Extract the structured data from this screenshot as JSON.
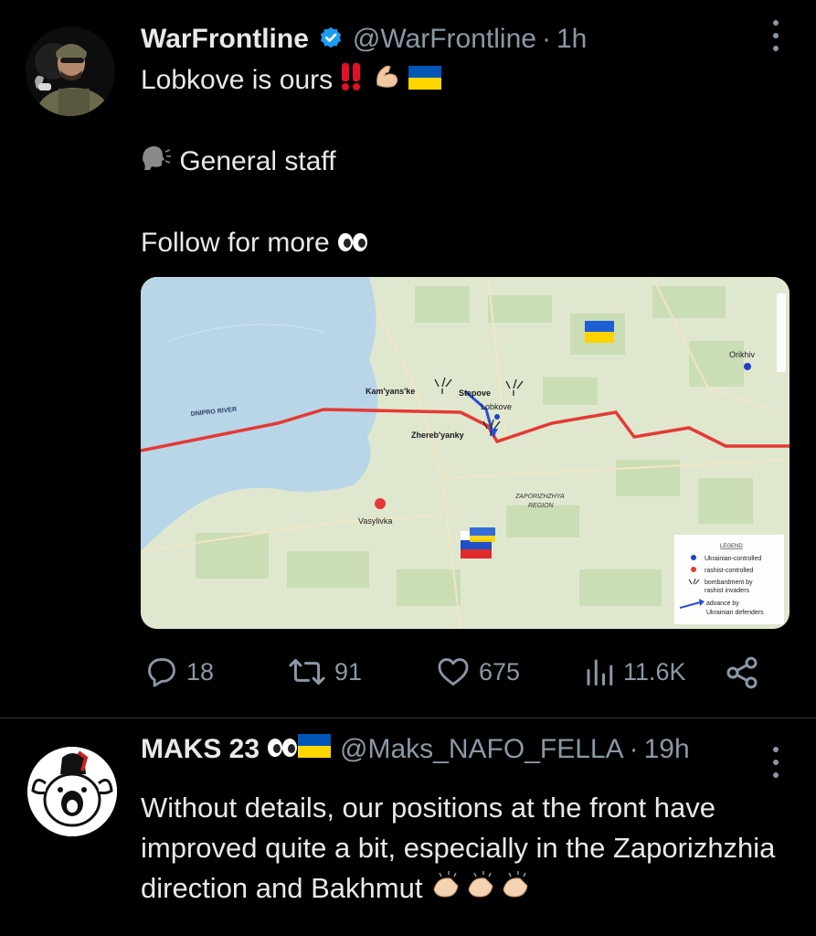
{
  "tweet1": {
    "author_name": "WarFrontline",
    "handle": "@WarFrontline",
    "separator": "·",
    "time": "1h",
    "line1": "Lobkove is ours",
    "line2": "General staff",
    "line3": "Follow for more",
    "stats": {
      "replies": "18",
      "retweets": "91",
      "likes": "675",
      "views": "11.6K"
    },
    "map": {
      "labels": {
        "river": "DNIPRO RIVER",
        "kamyanske": "Kam'yans'ke",
        "stepove": "Stepove",
        "lobkove": "Lobkove",
        "zherebyanky": "Zhereb'yanky",
        "orikhiv": "Orikhiv",
        "vasylivka": "Vasylivka",
        "region_1": "ZAPORIZHZHYA",
        "region_2": "REGION"
      },
      "legend": {
        "title": "LEGEND",
        "ukrainian": "Ukrainian-controlled",
        "rashist": "rashist-controlled",
        "bombardment_1": "bombardment by",
        "bombardment_2": "rashist invaders",
        "advance_1": "advance by",
        "advance_2": "Ukrainian defenders"
      },
      "colors": {
        "water": "#b9d6e8",
        "land": "#dfe8cf",
        "frontline": "#e53935",
        "ukraine_dot": "#1e40c8",
        "russia_dot": "#e53935"
      }
    }
  },
  "tweet2": {
    "author_name": "MAKS 23",
    "handle": "@Maks_NAFO_FELLA",
    "separator": "·",
    "time": "19h",
    "body": "Without details, our positions at the front have improved quite a bit, especially in the Zaporizhzhia direction and Bakhmut"
  },
  "icons": [
    "verified-badge-icon",
    "more-options-icon",
    "reply-icon",
    "retweet-icon",
    "like-icon",
    "views-icon",
    "share-icon"
  ],
  "colors": {
    "background": "#000000",
    "text": "#e7e9ea",
    "secondary": "#8b98a5",
    "verified": "#1d9bf0",
    "divider": "#2f3336"
  }
}
